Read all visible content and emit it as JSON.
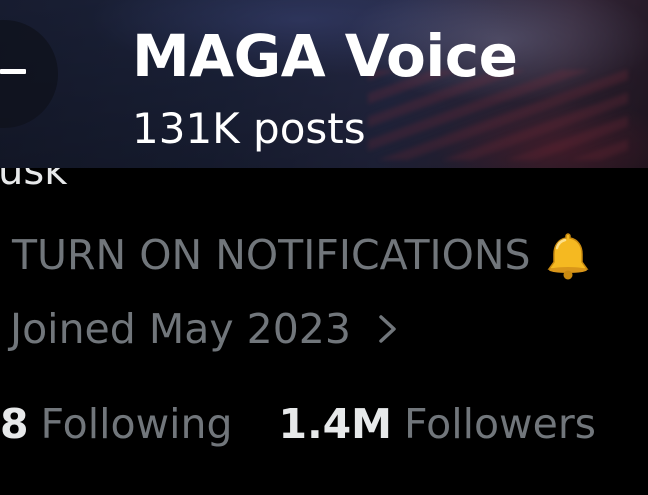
{
  "header": {
    "title": "MAGA Voice",
    "post_count": "131K posts"
  },
  "profile": {
    "clipped_handle_fragment": "usk",
    "bio": "TURN ON NOTIFICATIONS",
    "bio_emoji_icon": "bell-icon",
    "joined": "Joined May 2023"
  },
  "stats": {
    "following": {
      "value": "8",
      "label": "Following"
    },
    "followers": {
      "value": "1.4M",
      "label": "Followers"
    }
  },
  "colors": {
    "background": "#000000",
    "primary_text": "#e7e9ea",
    "secondary_text": "#71767b",
    "bell": "#f5b921"
  }
}
